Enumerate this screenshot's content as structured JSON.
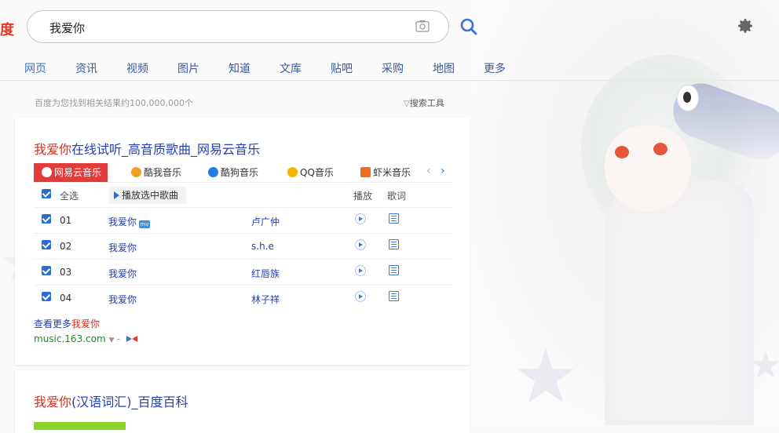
{
  "logo_fragment": "度",
  "search": {
    "query": "我爱你",
    "placeholder": ""
  },
  "nav_tabs": [
    "网页",
    "资讯",
    "视频",
    "图片",
    "知道",
    "文库",
    "贴吧",
    "采购",
    "地图",
    "更多"
  ],
  "result_count": "百度为您找到相关结果约100,000,000个",
  "search_tools": "搜索工具",
  "result1": {
    "title_highlight": "我爱你",
    "title_rest": "在线试听_高音质歌曲_网易云音乐",
    "music_tabs": [
      {
        "label": "网易云音乐",
        "color": "#e33a3a"
      },
      {
        "label": "酷我音乐",
        "color": "#f0a020"
      },
      {
        "label": "酷狗音乐",
        "color": "#1f7ee8"
      },
      {
        "label": "QQ音乐",
        "color": "#f4b400"
      },
      {
        "label": "虾米音乐",
        "color": "#ef6b1d"
      }
    ],
    "header": {
      "select_all": "全选",
      "play_selected": "播放选中歌曲",
      "play": "播放",
      "lyrics": "歌词"
    },
    "songs": [
      {
        "num": "01",
        "name": "我爱你",
        "artist": "卢广仲",
        "mv": true
      },
      {
        "num": "02",
        "name": "我爱你",
        "artist": "s.h.e",
        "mv": false
      },
      {
        "num": "03",
        "name": "我爱你",
        "artist": "红唇族",
        "mv": false
      },
      {
        "num": "04",
        "name": "我爱你",
        "artist": "林子祥",
        "mv": false
      }
    ],
    "more_prefix": "查看更多",
    "more_highlight": "我爱你",
    "source": "music.163.com"
  },
  "result2": {
    "title_highlight": "我爱你",
    "title_rest": "(汉语词汇)_百度百科"
  },
  "colors": {
    "link": "#2440b3",
    "highlight": "#d0321c",
    "accent": "#3b7ad8",
    "source_green": "#1f8a2a"
  }
}
